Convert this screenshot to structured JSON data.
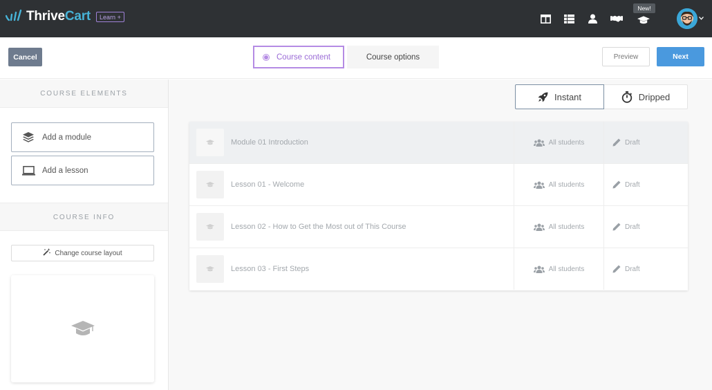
{
  "brand": {
    "name_part1": "Thrive",
    "name_part2": "Cart",
    "badge": "Learn +"
  },
  "topnav": {
    "icons": [
      "layout-icon",
      "table-icon",
      "user-icon",
      "handshake-icon",
      "graduation-cap-icon"
    ],
    "new_badge": "New!"
  },
  "actionbar": {
    "cancel_label": "Cancel",
    "tabs": [
      {
        "label": "Course content",
        "active": true
      },
      {
        "label": "Course options",
        "active": false
      }
    ],
    "preview_label": "Preview",
    "next_label": "Next"
  },
  "sidebar": {
    "elements_heading": "COURSE ELEMENTS",
    "add_module_label": "Add a module",
    "add_lesson_label": "Add a lesson",
    "info_heading": "COURSE INFO",
    "change_layout_label": "Change course layout"
  },
  "main": {
    "toggle": {
      "instant_label": "Instant",
      "dripped_label": "Dripped",
      "selected": "Instant"
    },
    "rows": [
      {
        "title": "Module 01 Introduction",
        "audience": "All students",
        "status": "Draft"
      },
      {
        "title": "Lesson 01 - Welcome",
        "audience": "All students",
        "status": "Draft"
      },
      {
        "title": "Lesson 02 - How to Get the Most out of This Course",
        "audience": "All students",
        "status": "Draft"
      },
      {
        "title": "Lesson 03 - First Steps",
        "audience": "All students",
        "status": "Draft"
      }
    ]
  },
  "colors": {
    "topnav_bg": "#2e3134",
    "brand_accent": "#47b3d7",
    "active_tab": "#b48be4",
    "next_button": "#4a99de",
    "cancel_button": "#6e7b8e"
  }
}
